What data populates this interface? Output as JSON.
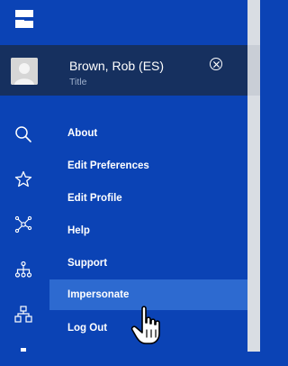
{
  "user": {
    "name": "Brown, Rob (ES)",
    "title": "Title"
  },
  "menu": {
    "items": [
      {
        "label": "About"
      },
      {
        "label": "Edit Preferences"
      },
      {
        "label": "Edit Profile"
      },
      {
        "label": "Help"
      },
      {
        "label": "Support"
      },
      {
        "label": "Impersonate",
        "highlighted": true
      },
      {
        "label": "Log Out"
      }
    ]
  },
  "rail": {
    "icons": [
      "search-icon",
      "star-icon",
      "network-icon",
      "hierarchy-icon",
      "org-chart-icon"
    ]
  },
  "colors": {
    "panel": "#0b43b5",
    "header": "#16305f",
    "highlight": "#2d6ad0"
  }
}
